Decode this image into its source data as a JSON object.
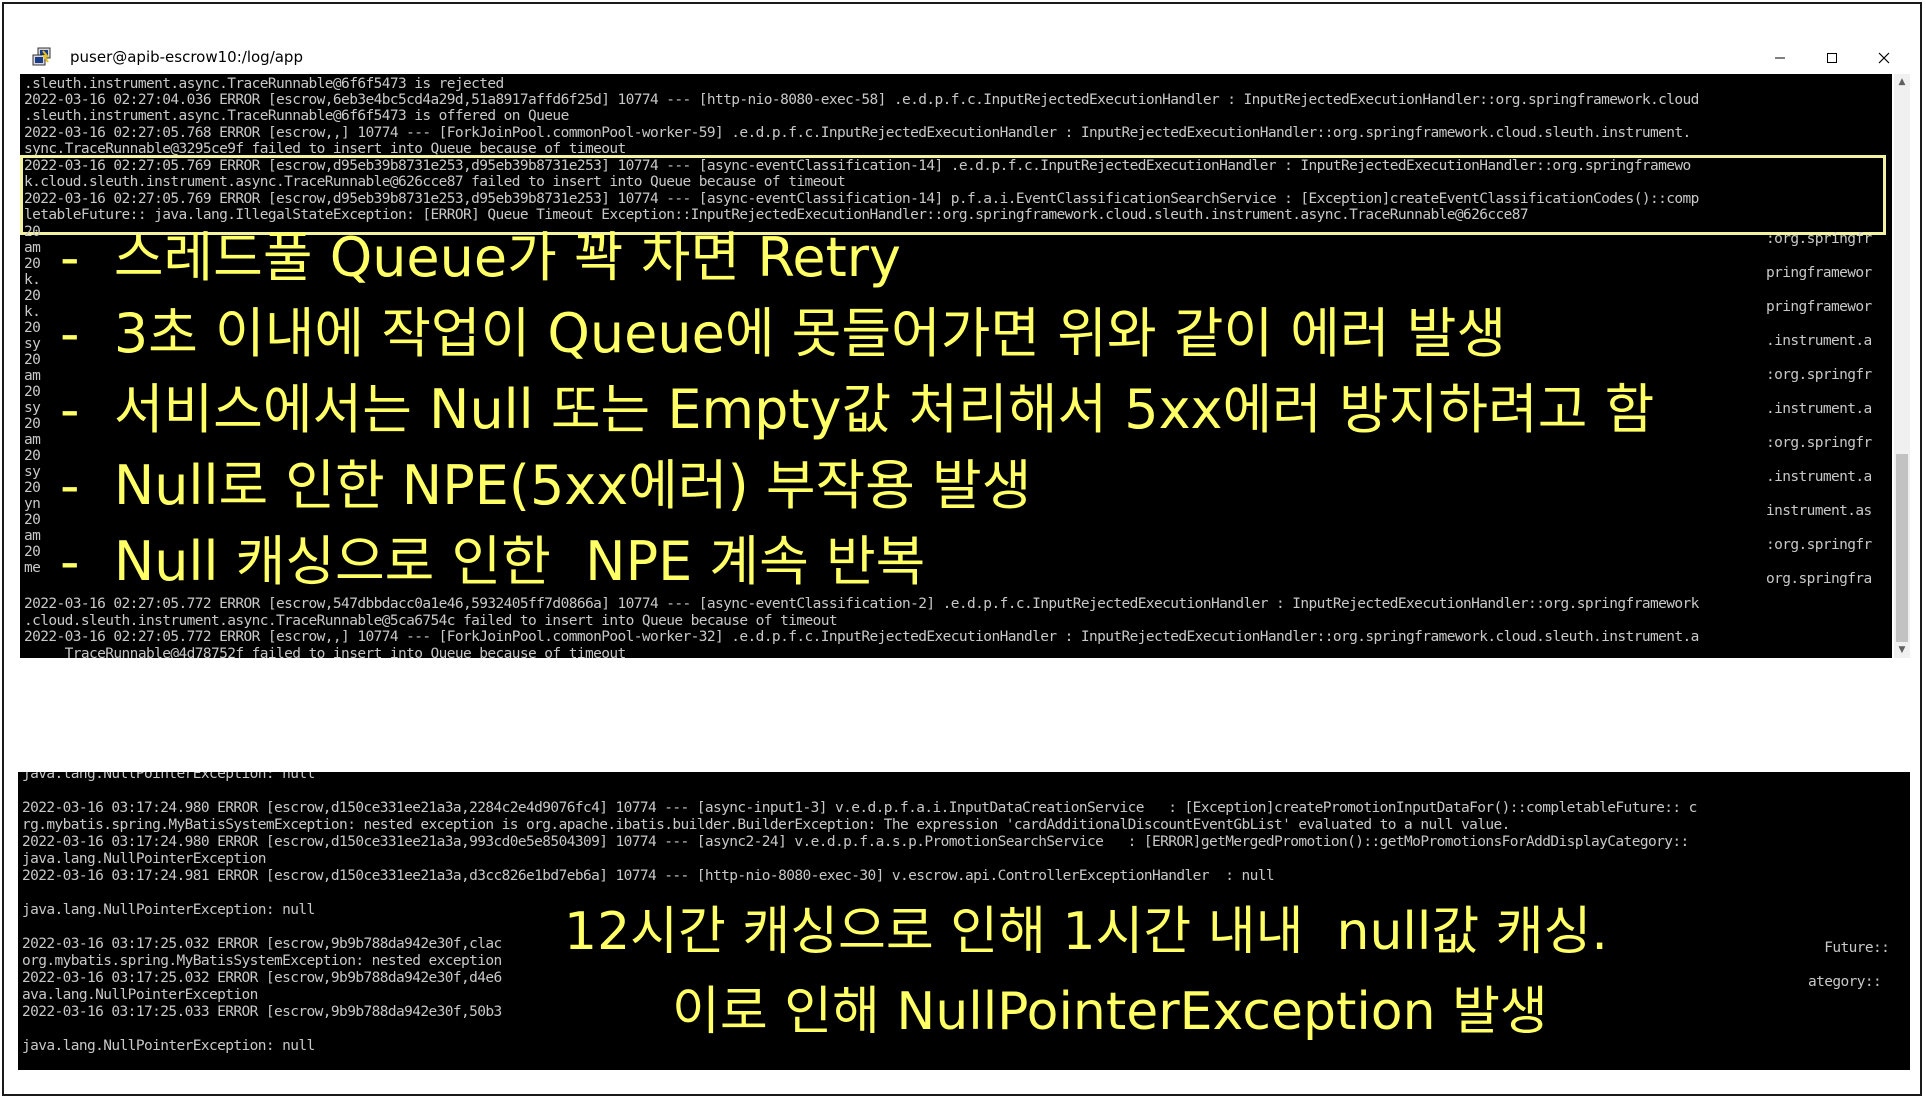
{
  "window": {
    "title": "puser@apib-escrow10:/log/app",
    "minimize": "—",
    "maximize": "☐",
    "close": "✕"
  },
  "terminal1": {
    "lines": [
      ".sleuth.instrument.async.TraceRunnable@6f6f5473 is rejected",
      "2022-03-16 02:27:04.036 ERROR [escrow,6eb3e4bc5cd4a29d,51a8917affd6f25d] 10774 --- [http-nio-8080-exec-58] .e.d.p.f.c.InputRejectedExecutionHandler : InputRejectedExecutionHandler::org.springframework.cloud",
      ".sleuth.instrument.async.TraceRunnable@6f6f5473 is offered on Queue",
      "2022-03-16 02:27:05.768 ERROR [escrow,,] 10774 --- [ForkJoinPool.commonPool-worker-59] .e.d.p.f.c.InputRejectedExecutionHandler : InputRejectedExecutionHandler::org.springframework.cloud.sleuth.instrument.",
      "sync.TraceRunnable@3295ce9f failed to insert into Queue because of timeout",
      "2022-03-16 02:27:05.769 ERROR [escrow,d95eb39b8731e253,d95eb39b8731e253] 10774 --- [async-eventClassification-14] .e.d.p.f.c.InputRejectedExecutionHandler : InputRejectedExecutionHandler::org.springframewo",
      "k.cloud.sleuth.instrument.async.TraceRunnable@626cce87 failed to insert into Queue because of timeout",
      "2022-03-16 02:27:05.769 ERROR [escrow,d95eb39b8731e253,d95eb39b8731e253] 10774 --- [async-eventClassification-14] p.f.a.i.EventClassificationSearchService : [Exception]createEventClassificationCodes()::comp",
      "letableFuture:: java.lang.IllegalStateException: [ERROR] Queue Timeout Exception::InputRejectedExecutionHandler::org.springframework.cloud.sleuth.instrument.async.TraceRunnable@626cce87"
    ],
    "left_fragments": [
      "20",
      "am",
      "20",
      "k.",
      "20",
      "k.",
      "20",
      "sy",
      "20",
      "am",
      "20",
      "sy",
      "20",
      "am",
      "20",
      "sy",
      "20",
      "yn",
      "20",
      "am",
      "20",
      "me"
    ],
    "right_fragments": [
      ":org.springfr",
      "pringframewor",
      "pringframewor",
      ".instrument.a",
      ":org.springfr",
      ".instrument.a",
      ":org.springfr",
      ".instrument.a",
      "instrument.as",
      ":org.springfr",
      "org.springfra"
    ],
    "bottom_lines": [
      "2022-03-16 02:27:05.772 ERROR [escrow,547dbbdacc0a1e46,5932405ff7d0866a] 10774 --- [async-eventClassification-2] .e.d.p.f.c.InputRejectedExecutionHandler : InputRejectedExecutionHandler::org.springframework",
      ".cloud.sleuth.instrument.async.TraceRunnable@5ca6754c failed to insert into Queue because of timeout",
      "2022-03-16 02:27:05.772 ERROR [escrow,,] 10774 --- [ForkJoinPool.commonPool-worker-32] .e.d.p.f.c.InputRejectedExecutionHandler : InputRejectedExecutionHandler::org.springframework.cloud.sleuth.instrument.a",
      "     TraceRunnable@4d78752f failed to insert into Queue because of timeout"
    ],
    "notes": [
      "-  스레드풀 Queue가 꽉 차면 Retry",
      "-  3초 이내에 작업이 Queue에 못들어가면 위와 같이 에러 발생",
      "-  서비스에서는 Null 또는 Empty값 처리해서 5xx에러 방지하려고 함",
      "-  Null로 인한 NPE(5xx에러) 부작용 발생",
      "-  Null 캐싱으로 인한  NPE 계속 반복"
    ]
  },
  "terminal2": {
    "lines": [
      "java.lang.NullPointerException: null",
      "",
      "2022-03-16 03:17:24.980 ERROR [escrow,d150ce331ee21a3a,2284c2e4d9076fc4] 10774 --- [async-input1-3] v.e.d.p.f.a.i.InputDataCreationService   : [Exception]createPromotionInputDataFor()::completableFuture:: c",
      "rg.mybatis.spring.MyBatisSystemException: nested exception is org.apache.ibatis.builder.BuilderException: The expression 'cardAdditionalDiscountEventGbList' evaluated to a null value.",
      "2022-03-16 03:17:24.980 ERROR [escrow,d150ce331ee21a3a,993cd0e5e8504309] 10774 --- [async2-24] v.e.d.p.f.a.s.p.PromotionSearchService   : [ERROR]getMergedPromotion()::getMoPromotionsForAddDisplayCategory::",
      "java.lang.NullPointerException",
      "2022-03-16 03:17:24.981 ERROR [escrow,d150ce331ee21a3a,d3cc826e1bd7eb6a] 10774 --- [http-nio-8080-exec-30] v.escrow.api.ControllerExceptionHandler  : null",
      "",
      "java.lang.NullPointerException: null",
      "",
      "2022-03-16 03:17:25.032 ERROR [escrow,9b9b788da942e30f,clac",
      "org.mybatis.spring.MyBatisSystemException: nested exception",
      "2022-03-16 03:17:25.032 ERROR [escrow,9b9b788da942e30f,d4e6",
      "ava.lang.NullPointerException",
      "2022-03-16 03:17:25.033 ERROR [escrow,9b9b788da942e30f,50b3",
      "",
      "java.lang.NullPointerException: null"
    ],
    "right_fragments": [
      "leFuture::",
      "ategory::"
    ],
    "notes": [
      "12시간 캐싱으로 인해 1시간 내내  null값 캐싱.",
      "이로 인해 NullPointerException 발생"
    ]
  },
  "colors": {
    "highlight": "#ffff66",
    "terminal_bg": "#000000",
    "terminal_text": "#c8c8c8"
  }
}
